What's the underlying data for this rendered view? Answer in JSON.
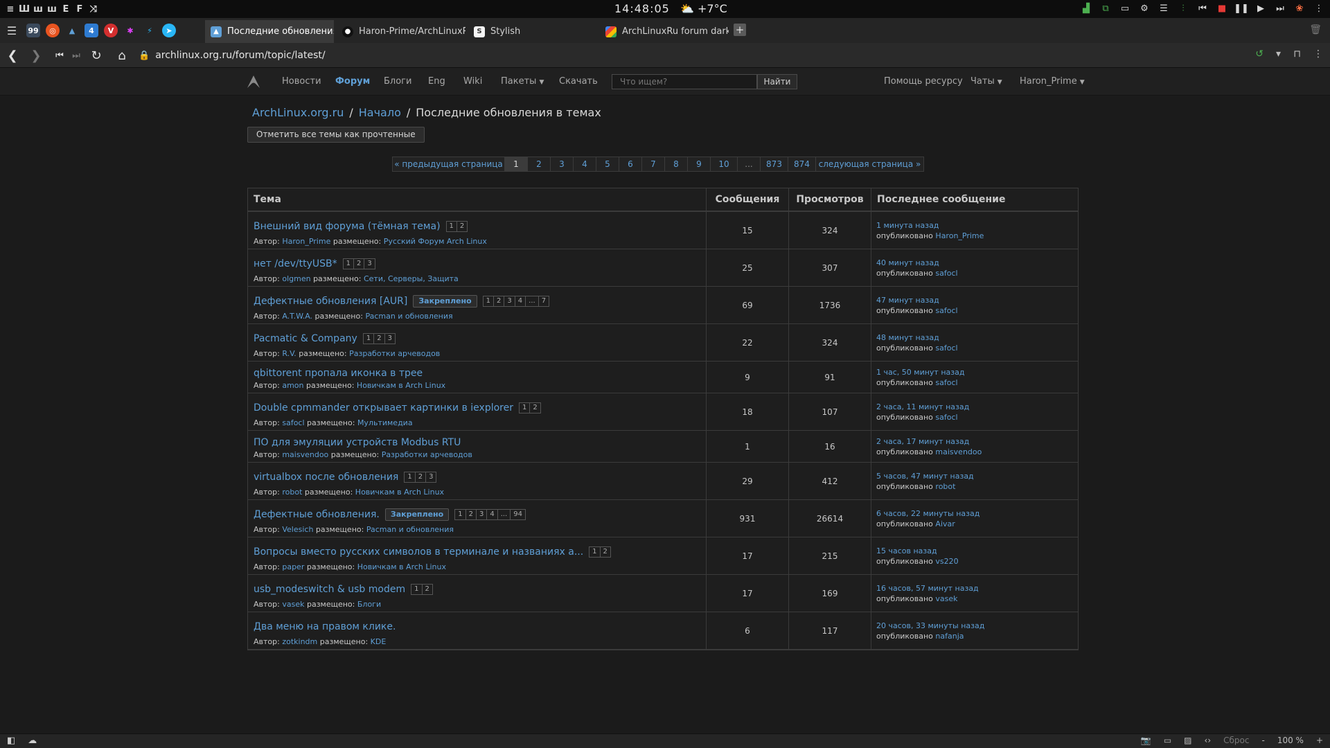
{
  "system": {
    "wm_icons": [
      "menu-icon",
      "tile-icon",
      "monocle-icon",
      "float-icon",
      "grid-icon",
      "shuffle-icon"
    ],
    "clock": "14:48:05",
    "weather": "⛅ +7°C"
  },
  "tabs": [
    {
      "label": "Последние обновления в т",
      "favicon": "arch-icon",
      "active": true
    },
    {
      "label": "Haron-Prime/ArchLinuxRuD",
      "favicon": "github-icon",
      "active": false
    },
    {
      "label": "Stylish",
      "favicon": "stylish-icon",
      "active": false
    },
    {
      "label": "ArchLinuxRu forum dark sty",
      "favicon": "google-icon",
      "active": false
    }
  ],
  "address": {
    "url": "archlinux.org.ru/forum/topic/latest/"
  },
  "sitenav": {
    "items": [
      "Новости",
      "Форум",
      "Блоги",
      "Eng",
      "Wiki",
      "Пакеты",
      "Скачать"
    ],
    "active": "Форум",
    "search_placeholder": "Что ищем?",
    "search_button": "Найти",
    "right_items": [
      "Помощь ресурсу",
      "Чаты",
      "Haron_Prime"
    ]
  },
  "breadcrumb": {
    "site": "ArchLinux.org.ru",
    "home": "Начало",
    "current": "Последние обновления в темах"
  },
  "mark_read": "Отметить все темы как прочтенные",
  "pager": [
    "« предыдущая страница",
    "1",
    "2",
    "3",
    "4",
    "5",
    "6",
    "7",
    "8",
    "9",
    "10",
    "...",
    "873",
    "874",
    "следующая страница »"
  ],
  "table": {
    "headers": [
      "Тема",
      "Сообщения",
      "Просмотров",
      "Последнее сообщение"
    ],
    "author_label": "Автор:",
    "placed_label": "размещено:",
    "published_label": "опубликовано",
    "sticky_label": "Закреплено",
    "rows": [
      {
        "title": "Внешний вид форума (тёмная тема)",
        "pages": [
          "1",
          "2"
        ],
        "sticky": false,
        "author": "Haron_Prime",
        "forum": "Русский Форум Arch Linux",
        "posts": "15",
        "views": "324",
        "last_time": "1 минута назад",
        "last_user": "Haron_Prime"
      },
      {
        "title": "нет /dev/ttyUSB*",
        "pages": [
          "1",
          "2",
          "3"
        ],
        "sticky": false,
        "author": "olgmen",
        "forum": "Сети, Серверы, Защита",
        "posts": "25",
        "views": "307",
        "last_time": "40 минут назад",
        "last_user": "safocl"
      },
      {
        "title": "Дефектные обновления [AUR]",
        "pages": [
          "1",
          "2",
          "3",
          "4",
          "...",
          "7"
        ],
        "sticky": true,
        "author": "A.T.W.A.",
        "forum": "Pacman и обновления",
        "posts": "69",
        "views": "1736",
        "last_time": "47 минут назад",
        "last_user": "safocl"
      },
      {
        "title": "Pacmatic & Company",
        "pages": [
          "1",
          "2",
          "3"
        ],
        "sticky": false,
        "author": "R.V.",
        "forum": "Разработки арчеводов",
        "posts": "22",
        "views": "324",
        "last_time": "48 минут назад",
        "last_user": "safocl"
      },
      {
        "title": "qbittorent пропала иконка в трее",
        "pages": [],
        "sticky": false,
        "author": "amon",
        "forum": "Новичкам в Arch Linux",
        "posts": "9",
        "views": "91",
        "last_time": "1 час, 50 минут назад",
        "last_user": "safocl"
      },
      {
        "title": "Double cpmmander открывает картинки в iexplorer",
        "pages": [
          "1",
          "2"
        ],
        "sticky": false,
        "author": "safocl",
        "forum": "Мультимедиа",
        "posts": "18",
        "views": "107",
        "last_time": "2 часа, 11 минут назад",
        "last_user": "safocl"
      },
      {
        "title": "ПО для эмуляции устройств Modbus RTU",
        "pages": [],
        "sticky": false,
        "author": "maisvendoo",
        "forum": "Разработки арчеводов",
        "posts": "1",
        "views": "16",
        "last_time": "2 часа, 17 минут назад",
        "last_user": "maisvendoo"
      },
      {
        "title": "virtualbox после обновления",
        "pages": [
          "1",
          "2",
          "3"
        ],
        "sticky": false,
        "author": "robot",
        "forum": "Новичкам в Arch Linux",
        "posts": "29",
        "views": "412",
        "last_time": "5 часов, 47 минут назад",
        "last_user": "robot"
      },
      {
        "title": "Дефектные обновления.",
        "pages": [
          "1",
          "2",
          "3",
          "4",
          "...",
          "94"
        ],
        "sticky": true,
        "author": "Velesich",
        "forum": "Pacman и обновления",
        "posts": "931",
        "views": "26614",
        "last_time": "6 часов, 22 минуты назад",
        "last_user": "Aivar"
      },
      {
        "title": "Вопросы вместо русских символов в терминале и названиях а...",
        "pages": [
          "1",
          "2"
        ],
        "sticky": false,
        "author": "paper",
        "forum": "Новичкам в Arch Linux",
        "posts": "17",
        "views": "215",
        "last_time": "15 часов назад",
        "last_user": "vs220"
      },
      {
        "title": "usb_modeswitch & usb modem",
        "pages": [
          "1",
          "2"
        ],
        "sticky": false,
        "author": "vasek",
        "forum": "Блоги",
        "posts": "17",
        "views": "169",
        "last_time": "16 часов, 57 минут назад",
        "last_user": "vasek"
      },
      {
        "title": "Два меню на правом клике.",
        "pages": [],
        "sticky": false,
        "author": "zotkindm",
        "forum": "KDE",
        "posts": "6",
        "views": "117",
        "last_time": "20 часов, 33 минуты назад",
        "last_user": "nafanja"
      }
    ]
  },
  "statusbar": {
    "reset": "Сброс",
    "zoom": "100 %"
  },
  "colors": {
    "link": "#5f9fd6",
    "background": "#1b1b1b",
    "border": "#3b3b3b"
  }
}
